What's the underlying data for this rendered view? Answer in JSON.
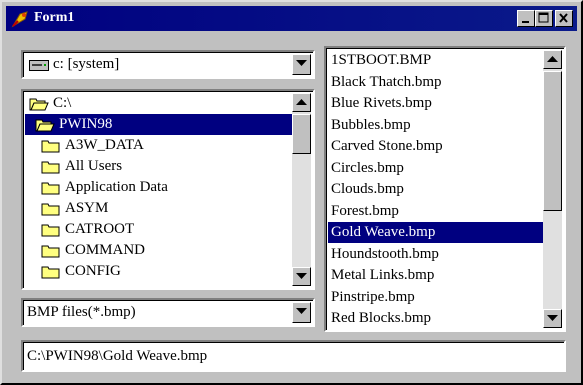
{
  "window": {
    "title": "Form1"
  },
  "drive": {
    "value": "c: [system]",
    "icon": "drive-icon"
  },
  "dirs": [
    {
      "label": "C:\\",
      "icon": "open-folder-icon",
      "selected": false
    },
    {
      "label": "PWIN98",
      "icon": "open-folder-icon",
      "selected": true
    },
    {
      "label": "A3W_DATA",
      "icon": "folder-icon",
      "selected": false
    },
    {
      "label": "All Users",
      "icon": "folder-icon",
      "selected": false
    },
    {
      "label": "Application Data",
      "icon": "folder-icon",
      "selected": false
    },
    {
      "label": "ASYM",
      "icon": "folder-icon",
      "selected": false
    },
    {
      "label": "CATROOT",
      "icon": "folder-icon",
      "selected": false
    },
    {
      "label": "COMMAND",
      "icon": "folder-icon",
      "selected": false
    },
    {
      "label": "CONFIG",
      "icon": "folder-icon",
      "selected": false
    }
  ],
  "files": [
    {
      "label": "1STBOOT.BMP",
      "selected": false
    },
    {
      "label": "Black Thatch.bmp",
      "selected": false
    },
    {
      "label": "Blue Rivets.bmp",
      "selected": false
    },
    {
      "label": "Bubbles.bmp",
      "selected": false
    },
    {
      "label": "Carved Stone.bmp",
      "selected": false
    },
    {
      "label": "Circles.bmp",
      "selected": false
    },
    {
      "label": "Clouds.bmp",
      "selected": false
    },
    {
      "label": "Forest.bmp",
      "selected": false
    },
    {
      "label": "Gold Weave.bmp",
      "selected": true
    },
    {
      "label": "Houndstooth.bmp",
      "selected": false
    },
    {
      "label": "Metal Links.bmp",
      "selected": false
    },
    {
      "label": "Pinstripe.bmp",
      "selected": false
    },
    {
      "label": "Red Blocks.bmp",
      "selected": false
    }
  ],
  "filter": {
    "value": "BMP files(*.bmp)"
  },
  "path": {
    "value": "C:\\PWIN98\\Gold Weave.bmp"
  },
  "colors": {
    "title_bar": "#000080",
    "face": "#c0c0c0",
    "selection": "#000080"
  }
}
